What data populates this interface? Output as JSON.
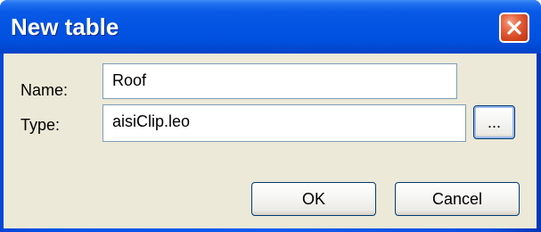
{
  "window": {
    "title": "New table"
  },
  "titlebar": {
    "close_icon": "close-icon"
  },
  "form": {
    "name_label": "Name:",
    "name_value": "Roof",
    "type_label": "Type:",
    "type_value": "aisiClip.leo",
    "browse_label": "..."
  },
  "buttons": {
    "ok_label": "OK",
    "cancel_label": "Cancel"
  },
  "colors": {
    "titlebar_blue": "#0454e3",
    "client_background": "#ece9d8",
    "close_red": "#d14420",
    "input_border": "#7f9db9",
    "button_border": "#003c74"
  }
}
